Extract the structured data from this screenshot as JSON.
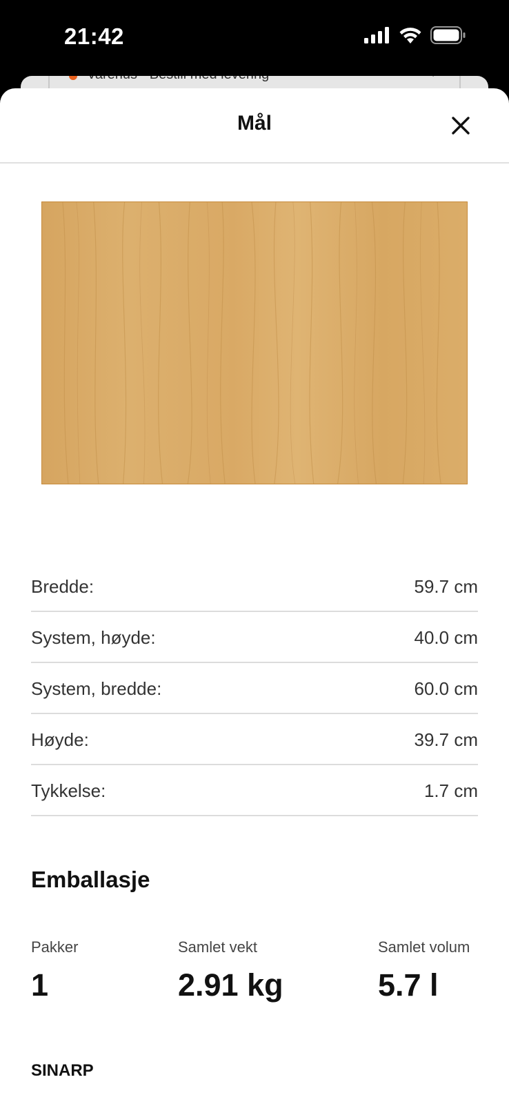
{
  "status_bar": {
    "time": "21:42",
    "icons": [
      "signal-icon",
      "wifi-icon",
      "battery-icon"
    ]
  },
  "background_sheet": {
    "text": "Varehus - Bestill med levering",
    "status_dot_color": "#e9611e"
  },
  "sheet": {
    "title": "Mål",
    "close_icon": "close-icon"
  },
  "product_image": {
    "description_icon": "wood-panel-image"
  },
  "dimensions": [
    {
      "label": "Bredde:",
      "value": "59.7 cm"
    },
    {
      "label": "System, høyde:",
      "value": "40.0 cm"
    },
    {
      "label": "System, bredde:",
      "value": "60.0 cm"
    },
    {
      "label": "Høyde:",
      "value": "39.7 cm"
    },
    {
      "label": "Tykkelse:",
      "value": "1.7 cm"
    }
  ],
  "packaging": {
    "title": "Emballasje",
    "columns": [
      {
        "label": "Pakker",
        "value": "1"
      },
      {
        "label": "Samlet vekt",
        "value": "2.91 kg"
      },
      {
        "label": "Samlet volum",
        "value": "5.7 l"
      }
    ]
  },
  "product_name": "SINARP"
}
